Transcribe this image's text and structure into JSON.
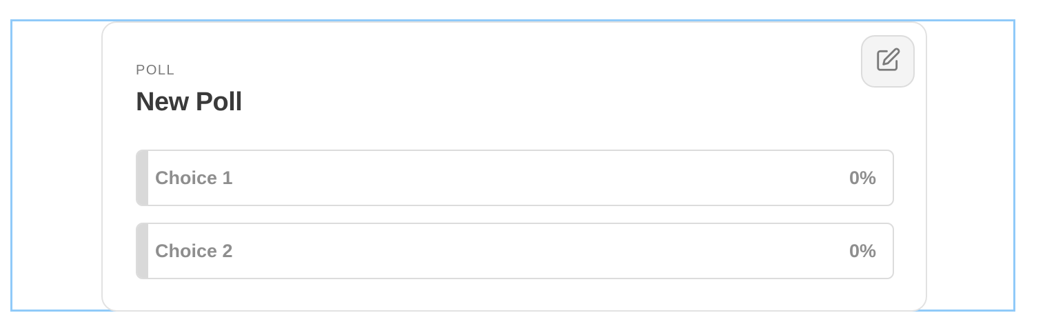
{
  "poll": {
    "kind_label": "POLL",
    "title": "New Poll",
    "edit_icon": "edit-icon",
    "choices": [
      {
        "label": "Choice 1",
        "percent": "0%",
        "fraction": 0
      },
      {
        "label": "Choice 2",
        "percent": "0%",
        "fraction": 0
      }
    ]
  },
  "colors": {
    "selection_outline": "#90caf9",
    "title_text": "#3a3a3a",
    "muted_text": "#8e8e8e",
    "bar_fill": "#d9d9d9",
    "border": "#dcdcdc"
  }
}
